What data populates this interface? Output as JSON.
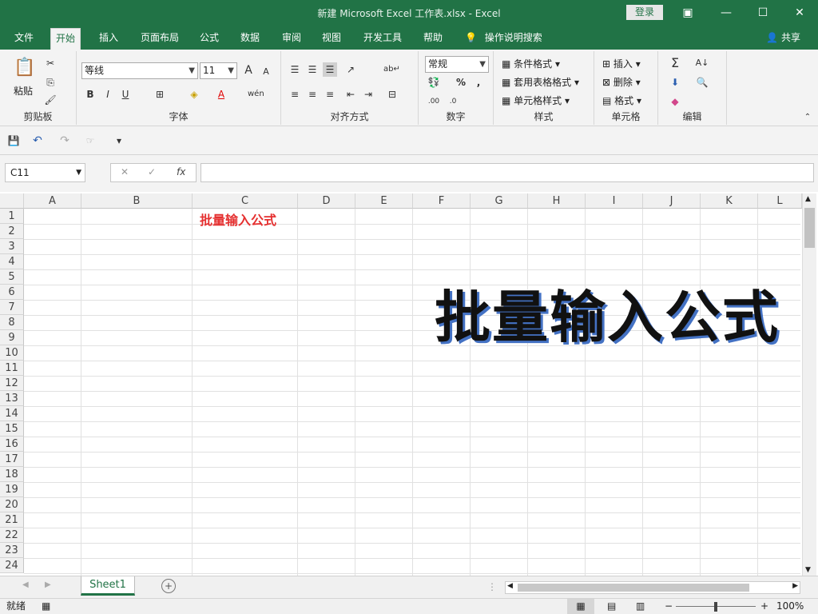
{
  "window": {
    "title": "新建 Microsoft Excel 工作表.xlsx  -  Excel",
    "login": "登录"
  },
  "tabs": [
    "文件",
    "开始",
    "插入",
    "页面布局",
    "公式",
    "数据",
    "审阅",
    "视图",
    "开发工具",
    "帮助"
  ],
  "tell_me": "操作说明搜索",
  "share": "共享",
  "ribbon": {
    "clipboard": {
      "label": "剪贴板",
      "paste": "粘贴"
    },
    "font": {
      "label": "字体",
      "name": "等线",
      "size": "11",
      "bold": "B",
      "italic": "I",
      "underline": "U",
      "grow": "A",
      "shrink": "A"
    },
    "alignment": {
      "label": "对齐方式"
    },
    "number": {
      "label": "数字",
      "format": "常规",
      "percent": "%",
      "comma": ","
    },
    "styles": {
      "label": "样式",
      "cond": "条件格式",
      "table": "套用表格格式",
      "cell": "单元格样式"
    },
    "cells": {
      "label": "单元格",
      "insert": "插入",
      "delete": "删除",
      "format": "格式"
    },
    "editing": {
      "label": "编辑"
    }
  },
  "formula_bar": {
    "name_box": "C11",
    "fx": "fx",
    "value": ""
  },
  "columns": [
    "A",
    "B",
    "C",
    "D",
    "E",
    "F",
    "G",
    "H",
    "I",
    "J",
    "K",
    "L"
  ],
  "rows": [
    "1",
    "2",
    "3",
    "4",
    "5",
    "6",
    "7",
    "8",
    "9",
    "10",
    "11",
    "12",
    "13",
    "14",
    "15",
    "16",
    "17",
    "18",
    "19",
    "20",
    "21",
    "22",
    "23",
    "24"
  ],
  "cells": {
    "C1": "批量输入公式"
  },
  "overlay_text": "批量输入公式",
  "sheet_tabs": [
    "Sheet1"
  ],
  "status": {
    "mode": "就绪",
    "zoom": "100%"
  },
  "colors": {
    "excel_green": "#217346",
    "title_red": "#e53030",
    "shadow_blue": "#4472c4"
  }
}
